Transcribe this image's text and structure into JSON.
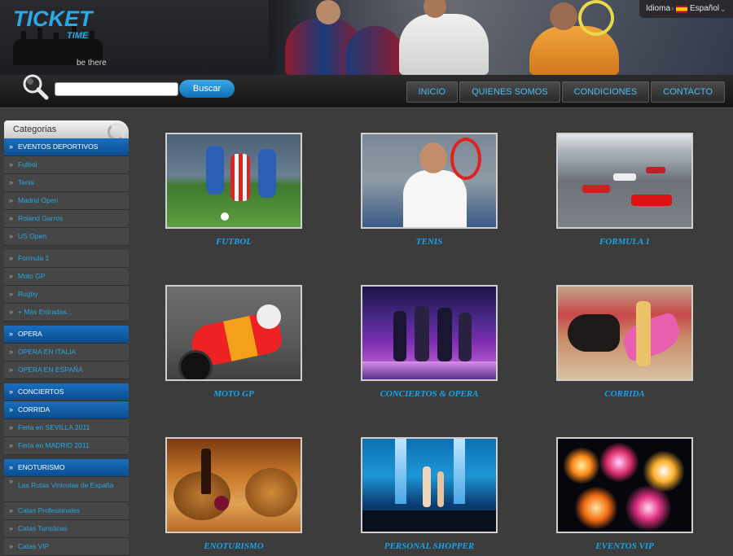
{
  "header": {
    "logo_title": "TICKET",
    "logo_sub": "TIME",
    "logo_slogan": "be there"
  },
  "language": {
    "label": "Idioma",
    "value": "Español",
    "flag_icon": "spain-flag-icon"
  },
  "search": {
    "placeholder": "",
    "button_label": "Buscar"
  },
  "menu": [
    "INICIO",
    "QUIENES SOMOS",
    "CONDICIONES",
    "CONTACTO"
  ],
  "sidebar": {
    "title": "Categorias",
    "items": [
      {
        "label": "EVENTOS DEPORTIVOS",
        "type": "section"
      },
      {
        "label": "Futbol",
        "type": "link"
      },
      {
        "label": "Tenis",
        "type": "link"
      },
      {
        "label": "Madrid Open",
        "type": "link"
      },
      {
        "label": "Roland Garros",
        "type": "link"
      },
      {
        "label": "US Open",
        "type": "link"
      },
      {
        "label": "Formula 1",
        "type": "link"
      },
      {
        "label": "Moto GP",
        "type": "link"
      },
      {
        "label": "Rugby",
        "type": "link"
      },
      {
        "label": "+ Más Entradas...",
        "type": "link"
      },
      {
        "label": "OPERA",
        "type": "section"
      },
      {
        "label": "OPERA EN ITALIA",
        "type": "link"
      },
      {
        "label": "OPERA EN ESPAÑA",
        "type": "link"
      },
      {
        "label": "CONCIERTOS",
        "type": "section"
      },
      {
        "label": "CORRIDA",
        "type": "section"
      },
      {
        "label": "Feria en SEVILLA 2011",
        "type": "link"
      },
      {
        "label": "Feria en MADRID 2011",
        "type": "link"
      },
      {
        "label": "ENOTURISMO",
        "type": "section"
      },
      {
        "label": "Las Rutas Vinicolas de España",
        "type": "link"
      },
      {
        "label": "Catas Profesionales",
        "type": "link"
      },
      {
        "label": "Catas Turisticas",
        "type": "link"
      },
      {
        "label": "Catas VIP",
        "type": "link"
      }
    ]
  },
  "tiles": [
    {
      "caption": "FUTBOL"
    },
    {
      "caption": "TENIS"
    },
    {
      "caption": "FORMULA 1"
    },
    {
      "caption": "MOTO GP"
    },
    {
      "caption": "CONCIERTOS & OPERA"
    },
    {
      "caption": "CORRIDA"
    },
    {
      "caption": "ENOTURISMO"
    },
    {
      "caption": "PERSONAL SHOPPER"
    },
    {
      "caption": "EVENTOS VIP"
    }
  ],
  "colors": {
    "accent": "#1aa3e8",
    "section_bg": "#0b4d8f",
    "page_bg": "#3c3c3c"
  }
}
